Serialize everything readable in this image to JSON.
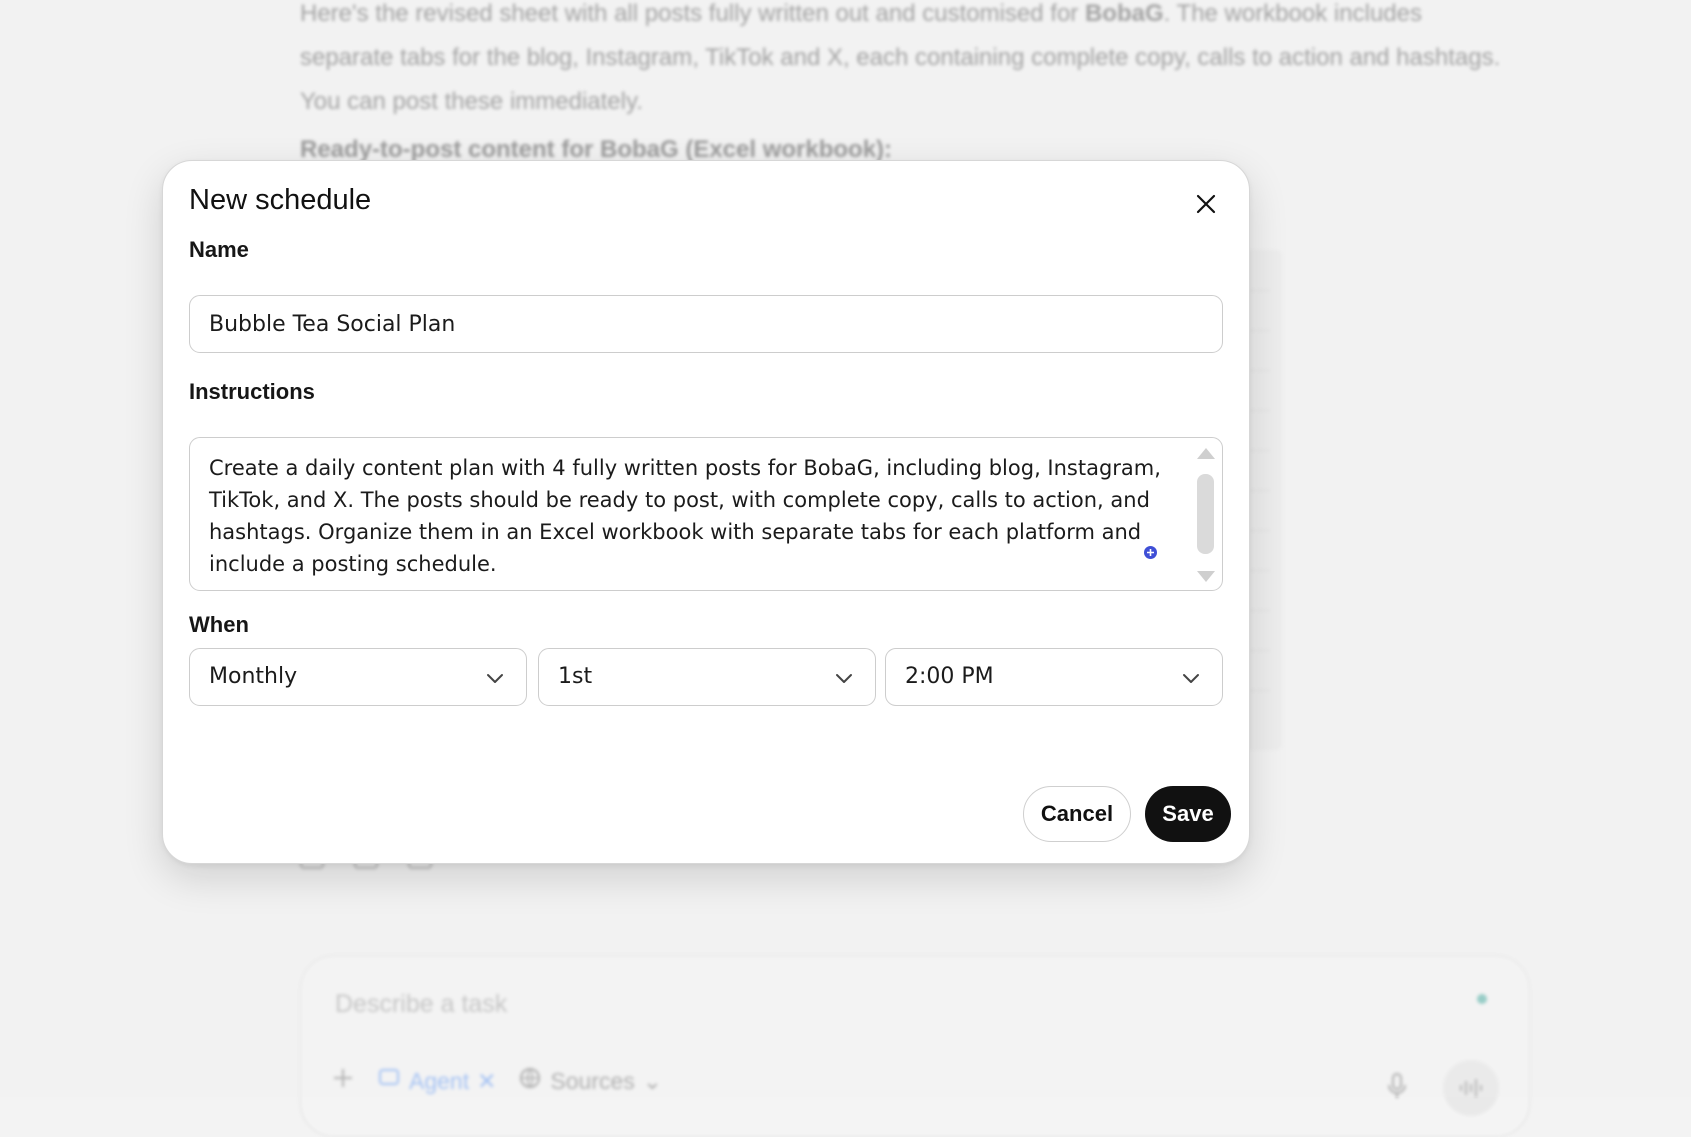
{
  "background": {
    "paragraph_parts": [
      "Here's the revised sheet with all posts fully written out and customised for ",
      "BobaG",
      ". The workbook includes separate tabs for the blog, Instagram, TikTok and X, each containing complete copy, calls to action and hashtags. You can post these immediately."
    ],
    "heading": "Ready-to-post content for BobaG (Excel workbook):",
    "composer": {
      "placeholder": "Describe a task",
      "agent_label": "Agent",
      "sources_label": "Sources"
    }
  },
  "modal": {
    "title": "New schedule",
    "name_label": "Name",
    "name_value": "Bubble Tea Social Plan",
    "instructions_label": "Instructions",
    "instructions_value": "Create a daily content plan with 4 fully written posts for BobaG, including blog, Instagram, TikTok, and X. The posts should be ready to post, with complete copy, calls to action, and hashtags. Organize them in an Excel workbook with separate tabs for each platform and include a posting schedule.",
    "when_label": "When",
    "frequency": "Monthly",
    "day": "1st",
    "time": "2:00 PM",
    "cancel_label": "Cancel",
    "save_label": "Save"
  },
  "colors": {
    "save_bg": "#111111",
    "agent_accent": "#3b82f6",
    "status_dot": "#1a9b8c",
    "add_dot": "#3f4fd6"
  }
}
